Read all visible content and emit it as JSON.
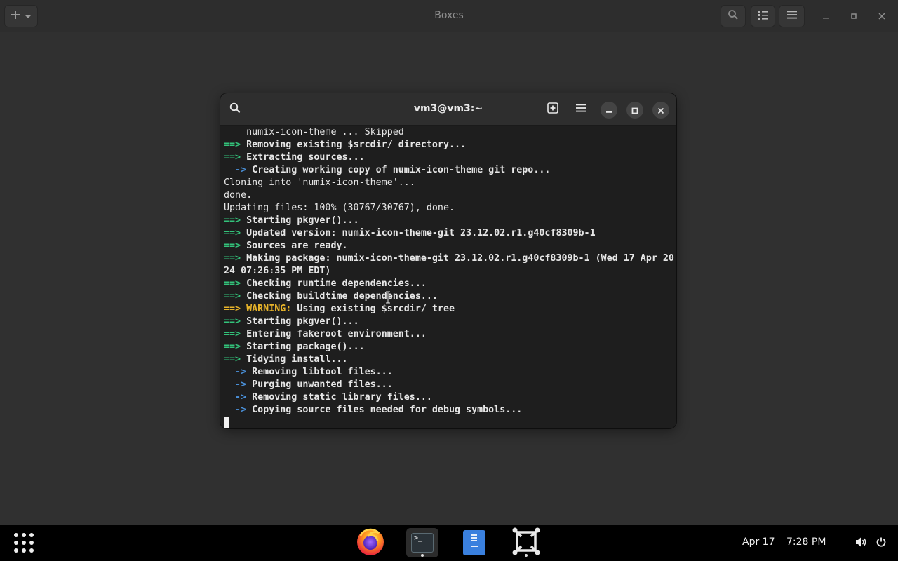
{
  "app": {
    "title": "Boxes",
    "icons": {
      "new": "plus-icon",
      "new_dropdown": "chevron-down-icon",
      "search": "search-icon",
      "view": "list-view-icon",
      "menu": "hamburger-menu-icon",
      "minimize": "minimize-icon",
      "maximize": "maximize-icon",
      "close": "close-icon"
    }
  },
  "terminal": {
    "title": "vm3@vm3:~",
    "lines": [
      [
        {
          "t": "    numix-icon-theme ... Skipped",
          "c": ""
        }
      ],
      [
        {
          "t": "==> ",
          "c": "g"
        },
        {
          "t": "Removing existing $srcdir/ directory...",
          "c": "b"
        }
      ],
      [
        {
          "t": "==> ",
          "c": "g"
        },
        {
          "t": "Extracting sources...",
          "c": "b"
        }
      ],
      [
        {
          "t": "  -> ",
          "c": "bl"
        },
        {
          "t": "Creating working copy of numix-icon-theme git repo...",
          "c": "b"
        }
      ],
      [
        {
          "t": "Cloning into 'numix-icon-theme'...",
          "c": ""
        }
      ],
      [
        {
          "t": "done.",
          "c": ""
        }
      ],
      [
        {
          "t": "Updating files: 100% (30767/30767), done.",
          "c": ""
        }
      ],
      [
        {
          "t": "==> ",
          "c": "g"
        },
        {
          "t": "Starting pkgver()...",
          "c": "b"
        }
      ],
      [
        {
          "t": "==> ",
          "c": "g"
        },
        {
          "t": "Updated version: numix-icon-theme-git 23.12.02.r1.g40cf8309b-1",
          "c": "b"
        }
      ],
      [
        {
          "t": "==> ",
          "c": "g"
        },
        {
          "t": "Sources are ready.",
          "c": "b"
        }
      ],
      [
        {
          "t": "==> ",
          "c": "g"
        },
        {
          "t": "Making package: numix-icon-theme-git 23.12.02.r1.g40cf8309b-1 (Wed 17 Apr 20",
          "c": "b"
        }
      ],
      [
        {
          "t": "24 07:26:35 PM EDT)",
          "c": "b"
        }
      ],
      [
        {
          "t": "==> ",
          "c": "g"
        },
        {
          "t": "Checking runtime dependencies...",
          "c": "b"
        }
      ],
      [
        {
          "t": "==> ",
          "c": "g"
        },
        {
          "t": "Checking buildtime dependencies...",
          "c": "b"
        }
      ],
      [
        {
          "t": "==> ",
          "c": "y"
        },
        {
          "t": "WARNING: ",
          "c": "y"
        },
        {
          "t": "Using existing $srcdir/ tree",
          "c": "b"
        }
      ],
      [
        {
          "t": "==> ",
          "c": "g"
        },
        {
          "t": "Starting pkgver()...",
          "c": "b"
        }
      ],
      [
        {
          "t": "==> ",
          "c": "g"
        },
        {
          "t": "Entering fakeroot environment...",
          "c": "b"
        }
      ],
      [
        {
          "t": "==> ",
          "c": "g"
        },
        {
          "t": "Starting package()...",
          "c": "b"
        }
      ],
      [
        {
          "t": "==> ",
          "c": "g"
        },
        {
          "t": "Tidying install...",
          "c": "b"
        }
      ],
      [
        {
          "t": "  -> ",
          "c": "bl"
        },
        {
          "t": "Removing libtool files...",
          "c": "b"
        }
      ],
      [
        {
          "t": "  -> ",
          "c": "bl"
        },
        {
          "t": "Purging unwanted files...",
          "c": "b"
        }
      ],
      [
        {
          "t": "  -> ",
          "c": "bl"
        },
        {
          "t": "Removing static library files...",
          "c": "b"
        }
      ],
      [
        {
          "t": "  -> ",
          "c": "bl"
        },
        {
          "t": "Copying source files needed for debug symbols...",
          "c": "b"
        }
      ]
    ],
    "colors": {
      "green": "#33c27a",
      "blue": "#4a90d9",
      "yellow": "#e8b42a",
      "background": "#1e1e1e"
    }
  },
  "taskbar": {
    "apps": [
      {
        "name": "Firefox",
        "icon": "firefox-icon"
      },
      {
        "name": "Terminal",
        "icon": "terminal-icon",
        "active": true
      },
      {
        "name": "Files",
        "icon": "files-icon"
      },
      {
        "name": "Boxes",
        "icon": "boxes-icon"
      }
    ],
    "date": "Apr 17",
    "time": "7:28 PM"
  }
}
